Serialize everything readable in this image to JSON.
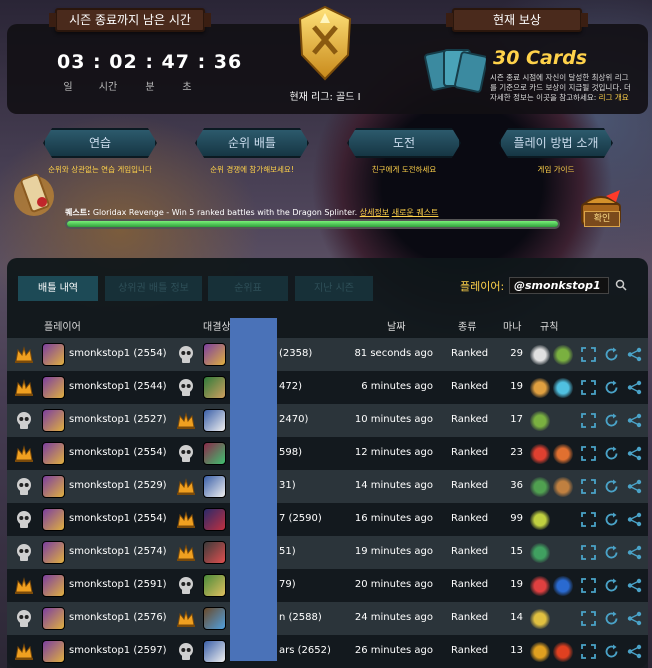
{
  "top": {
    "season_label": "시즌 종료까지 남은 시간",
    "timer": "03 : 02 : 47 : 36",
    "timer_units": [
      "일",
      "시간",
      "분",
      "초"
    ],
    "league": "현재 리그: 골드 I",
    "reward_label": "현재 보상",
    "reward_cards": "30 Cards",
    "reward_desc": "시즌 종료 시점에 자신이 달성한 최상위 리그를 기준으로 카드 보상이 지급될 것입니다. 더 자세한 정보는 이곳을 참고하세요:",
    "reward_link": "리그 개요"
  },
  "nav": [
    {
      "label": "연습",
      "desc": "순위와 상관없는 연습 게임입니다"
    },
    {
      "label": "순위 배틀",
      "desc": "순위 경쟁에 참가해보세요!"
    },
    {
      "label": "도전",
      "desc": "친구에게 도전하세요"
    },
    {
      "label": "플레이 방법 소개",
      "desc": "게임 가이드"
    }
  ],
  "quest": {
    "label": "퀘스트:",
    "text": "Gloridax Revenge - Win 5 ranked battles with the Dragon Splinter.",
    "details": "상세정보",
    "new": "새로운 퀘스트",
    "progress": 1.0,
    "claim": "확인"
  },
  "tabs": [
    "배틀 내역",
    "상위권 배틀 정보",
    "순위표",
    "지난 시즌"
  ],
  "player_label": "플레이어:",
  "player_value": "@smonkstop1",
  "headers": {
    "player": "플레이어",
    "opponent": "대결상대",
    "date": "날짜",
    "type": "종류",
    "mana": "마나",
    "rules": "규칙"
  },
  "rows": [
    {
      "result": "win",
      "player": "smonkstop1 (2554)",
      "opp": "(2358)",
      "date": "81 seconds ago",
      "type": "Ranked",
      "mana": "29"
    },
    {
      "result": "win",
      "player": "smonkstop1 (2544)",
      "opp": "472)",
      "date": "6 minutes ago",
      "type": "Ranked",
      "mana": "19"
    },
    {
      "result": "loss",
      "player": "smonkstop1 (2527)",
      "opp": "2470)",
      "date": "10 minutes ago",
      "type": "Ranked",
      "mana": "17"
    },
    {
      "result": "win",
      "player": "smonkstop1 (2554)",
      "opp": "598)",
      "date": "12 minutes ago",
      "type": "Ranked",
      "mana": "23"
    },
    {
      "result": "loss",
      "player": "smonkstop1 (2529)",
      "opp": "31)",
      "date": "14 minutes ago",
      "type": "Ranked",
      "mana": "36"
    },
    {
      "result": "loss",
      "player": "smonkstop1 (2554)",
      "opp": "7 (2590)",
      "date": "16 minutes ago",
      "type": "Ranked",
      "mana": "99"
    },
    {
      "result": "loss",
      "player": "smonkstop1 (2574)",
      "opp": "51)",
      "date": "19 minutes ago",
      "type": "Ranked",
      "mana": "15"
    },
    {
      "result": "win",
      "player": "smonkstop1 (2591)",
      "opp": "79)",
      "date": "20 minutes ago",
      "type": "Ranked",
      "mana": "19"
    },
    {
      "result": "loss",
      "player": "smonkstop1 (2576)",
      "opp": "n (2588)",
      "date": "24 minutes ago",
      "type": "Ranked",
      "mana": "14"
    },
    {
      "result": "win",
      "player": "smonkstop1 (2597)",
      "opp": "ars (2652)",
      "date": "26 minutes ago",
      "type": "Ranked",
      "mana": "13"
    }
  ],
  "colors": {
    "gold": "#ffd24a",
    "teal": "#1d4a56",
    "redact": "#4a72b8",
    "action_icon": "#4aa3c8"
  }
}
